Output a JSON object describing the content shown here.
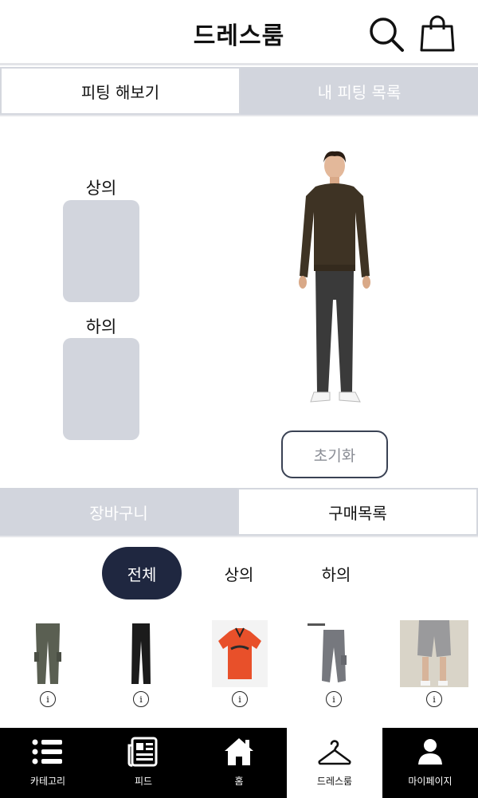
{
  "header": {
    "title": "드레스룸",
    "search_icon": "search-icon",
    "bag_icon": "shopping-bag-icon"
  },
  "top_tabs": [
    {
      "label": "피팅 해보기",
      "active": true
    },
    {
      "label": "내 피팅 목록",
      "active": false
    }
  ],
  "fitting": {
    "top_label": "상의",
    "bottom_label": "하의",
    "reset_label": "초기화"
  },
  "list_tabs": [
    {
      "label": "장바구니",
      "active": false
    },
    {
      "label": "구매목록",
      "active": true
    }
  ],
  "filters": [
    {
      "label": "전체",
      "active": true
    },
    {
      "label": "상의",
      "active": false
    },
    {
      "label": "하의",
      "active": false
    }
  ],
  "products": [
    {
      "kind": "cargo-pants-khaki",
      "info": "i"
    },
    {
      "kind": "black-pants",
      "info": "i"
    },
    {
      "kind": "orange-baseball-jersey",
      "info": "i"
    },
    {
      "kind": "grey-jogger-pants",
      "info": "i"
    },
    {
      "kind": "grey-shorts",
      "info": "i"
    }
  ],
  "bottom_nav": [
    {
      "label": "카테고리",
      "icon": "list-icon",
      "active": false
    },
    {
      "label": "피드",
      "icon": "newspaper-icon",
      "active": false
    },
    {
      "label": "홈",
      "icon": "home-icon",
      "active": false
    },
    {
      "label": "드레스룸",
      "icon": "hanger-icon",
      "active": true
    },
    {
      "label": "마이페이지",
      "icon": "user-icon",
      "active": false
    }
  ],
  "colors": {
    "accent": "#1f2740",
    "inactive_tab": "#d2d5dd",
    "nav_bg": "#000000"
  }
}
